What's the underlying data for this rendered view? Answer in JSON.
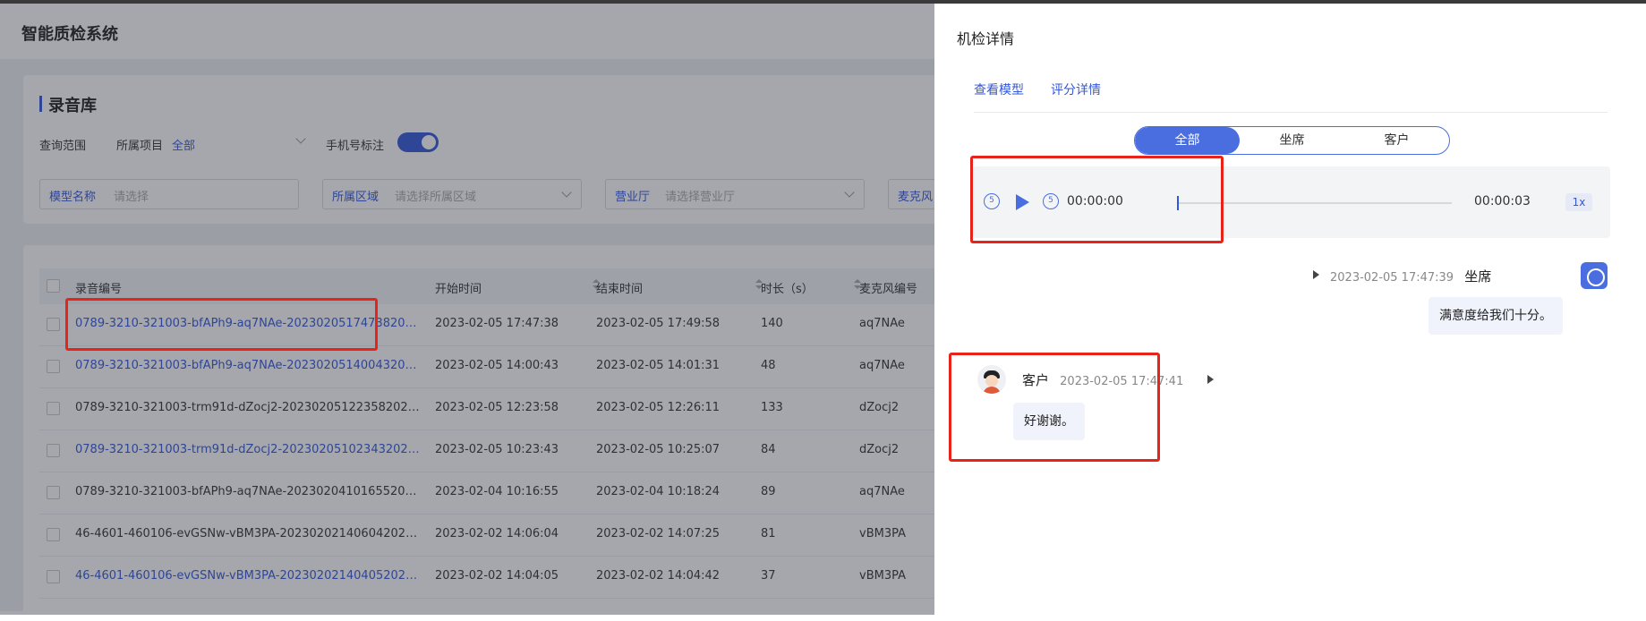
{
  "app": {
    "title": "智能质检系统",
    "section_title": "录音库",
    "filters": {
      "scope_label": "查询范围",
      "project_label": "所属项目",
      "project_value": "全部",
      "phone_mark_label": "手机号标注",
      "phone_mark_on": true,
      "model_name_label": "模型名称",
      "model_name_placeholder": "请选择",
      "region_label": "所属区域",
      "region_placeholder": "请选择所属区域",
      "hall_label": "营业厅",
      "hall_placeholder": "请选择营业厅",
      "mic_label": "麦克风"
    },
    "table": {
      "columns": [
        "录音编号",
        "开始时间",
        "结束时间",
        "时长（s）",
        "麦克风编号"
      ],
      "rows": [
        {
          "id": "0789-3210-321003-bfAPh9-aq7NAe-20230205174738202302...",
          "start": "2023-02-05 17:47:38",
          "end": "2023-02-05 17:49:58",
          "duration": "140",
          "mic": "aq7NAe",
          "link": true
        },
        {
          "id": "0789-3210-321003-bfAPh9-aq7NAe-20230205140043202302...",
          "start": "2023-02-05 14:00:43",
          "end": "2023-02-05 14:01:31",
          "duration": "48",
          "mic": "aq7NAe",
          "link": true
        },
        {
          "id": "0789-3210-321003-trm91d-dZocj2-20230205122358202302...",
          "start": "2023-02-05 12:23:58",
          "end": "2023-02-05 12:26:11",
          "duration": "133",
          "mic": "dZocj2",
          "link": false
        },
        {
          "id": "0789-3210-321003-trm91d-dZocj2-20230205102343202302...",
          "start": "2023-02-05 10:23:43",
          "end": "2023-02-05 10:25:07",
          "duration": "84",
          "mic": "dZocj2",
          "link": true
        },
        {
          "id": "0789-3210-321003-bfAPh9-aq7NAe-20230204101655202302...",
          "start": "2023-02-04 10:16:55",
          "end": "2023-02-04 10:18:24",
          "duration": "89",
          "mic": "aq7NAe",
          "link": false
        },
        {
          "id": "46-4601-460106-evGSNw-vBM3PA-20230202140604202302...",
          "start": "2023-02-02 14:06:04",
          "end": "2023-02-02 14:07:25",
          "duration": "81",
          "mic": "vBM3PA",
          "link": false
        },
        {
          "id": "46-4601-460106-evGSNw-vBM3PA-20230202140405202302...",
          "start": "2023-02-02 14:04:05",
          "end": "2023-02-02 14:04:42",
          "duration": "37",
          "mic": "vBM3PA",
          "link": true
        }
      ]
    }
  },
  "drawer": {
    "title": "机检详情",
    "tabs": [
      "查看模型",
      "评分详情"
    ],
    "segment": {
      "options": [
        "全部",
        "坐席",
        "客户"
      ],
      "selected": "全部"
    },
    "player": {
      "rewind_label": "5",
      "forward_label": "5",
      "current_time": "00:00:00",
      "total_time": "00:00:03",
      "speed": "1x",
      "progress": 0
    },
    "messages": [
      {
        "speaker": "坐席",
        "time": "2023-02-05 17:47:39",
        "text": "满意度给我们十分。",
        "side": "right"
      },
      {
        "speaker": "客户",
        "time": "2023-02-05 17:47:41",
        "text": "好谢谢。",
        "side": "left"
      }
    ]
  },
  "colors": {
    "accent": "#3557d6",
    "segment_active": "#4a6ee0",
    "highlight_red": "#e8231a"
  }
}
